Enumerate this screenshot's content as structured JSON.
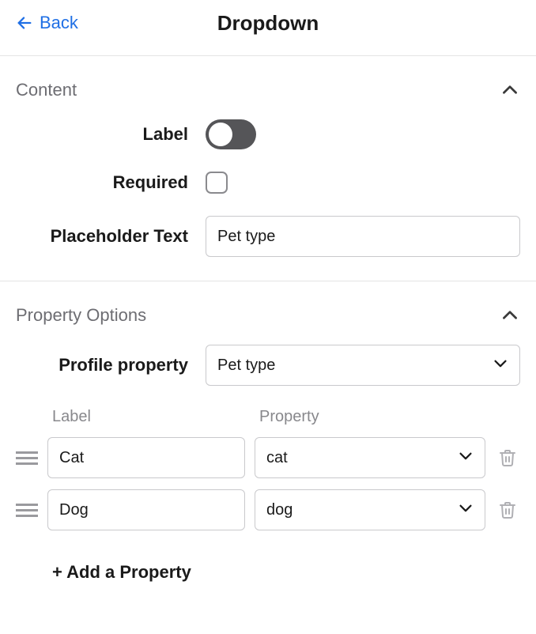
{
  "header": {
    "back_label": "Back",
    "title": "Dropdown"
  },
  "content": {
    "section_title": "Content",
    "label_field": "Label",
    "required_field": "Required",
    "placeholder_field": "Placeholder Text",
    "placeholder_value": "Pet type"
  },
  "property_options": {
    "section_title": "Property Options",
    "profile_property_field": "Profile property",
    "profile_property_value": "Pet type",
    "columns": {
      "label": "Label",
      "property": "Property"
    },
    "rows": [
      {
        "label": "Cat",
        "property": "cat"
      },
      {
        "label": "Dog",
        "property": "dog"
      }
    ],
    "add_label": "+ Add a Property"
  }
}
